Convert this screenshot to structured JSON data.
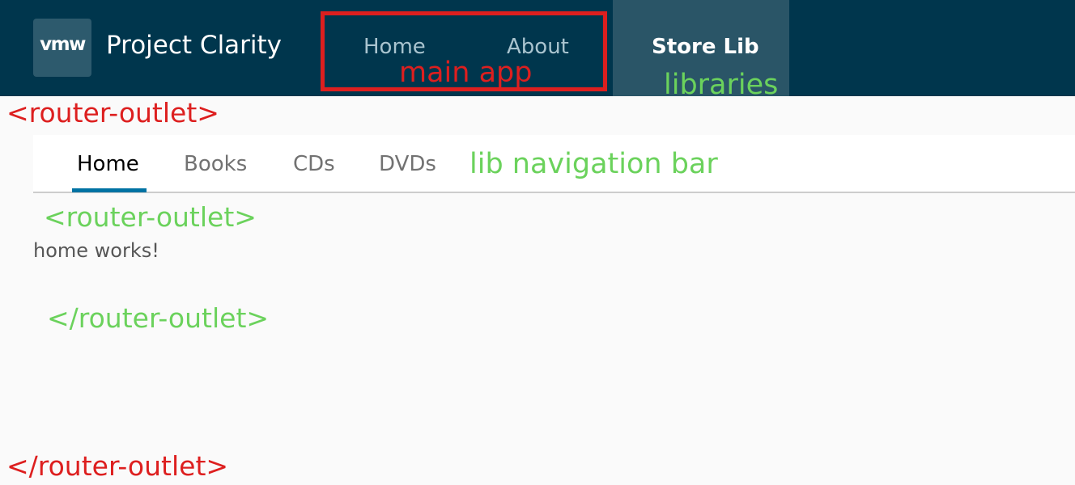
{
  "header": {
    "logo_text": "vmw",
    "title": "Project Clarity",
    "nav": [
      {
        "label": "Home"
      },
      {
        "label": "About"
      }
    ],
    "store_tab_label": "Store Lib"
  },
  "lib_nav": {
    "tabs": [
      {
        "label": "Home",
        "active": true
      },
      {
        "label": "Books",
        "active": false
      },
      {
        "label": "CDs",
        "active": false
      },
      {
        "label": "DVDs",
        "active": false
      }
    ]
  },
  "content": {
    "text": "home works!"
  },
  "annotations": {
    "main_app": "main app",
    "libraries": "libraries",
    "outer_open": "<router-outlet>",
    "outer_close": "</router-outlet>",
    "lib_navigation_bar": "lib navigation bar",
    "inner_open": "<router-outlet>",
    "inner_close": "</router-outlet>"
  },
  "colors": {
    "header_bg": "#00364d",
    "store_tab_bg": "#2a5567",
    "annotation_red": "#dd1f1f",
    "annotation_green": "#6bd25c",
    "active_tab_underline": "#0072a3",
    "page_bg": "#fafafa"
  }
}
